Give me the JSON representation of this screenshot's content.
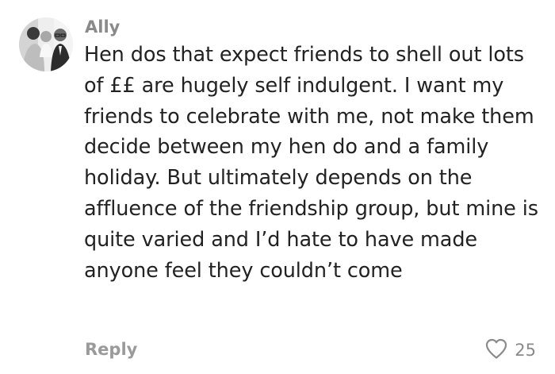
{
  "comment": {
    "author": "Ally",
    "text": "Hen dos that expect friends to shell out lots of ££ are hugely self indulgent. I want my friends to celebrate with me, not make them decide between my hen do and a family holiday. But ultimately depends on the affluence of the friendship group, but mine is quite varied and I’d hate to have made anyone feel they couldn’t come",
    "reply_label": "Reply",
    "like_count": "25",
    "avatar_icon": "avatar-photo-icon",
    "like_icon": "heart-outline-icon"
  }
}
